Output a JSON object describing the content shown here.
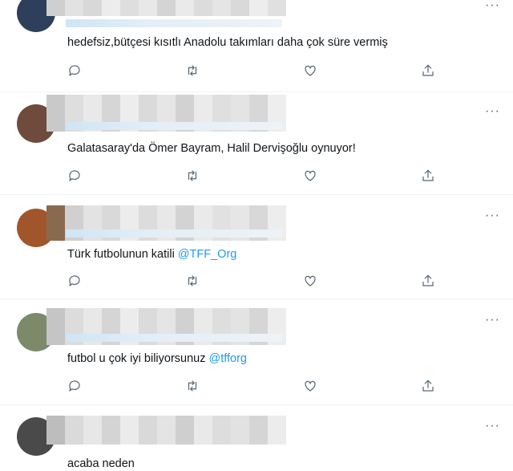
{
  "tweets": [
    {
      "text": "hedefsiz,bütçesi kısıtlı Anadolu takımları daha çok süre vermiş",
      "mention": "",
      "more_label": "···",
      "icons": [
        "reply-icon",
        "retweet-icon",
        "like-icon",
        "share-icon"
      ]
    },
    {
      "text": "Galatasaray'da Ömer Bayram, Halil Dervişoğlu oynuyor!",
      "mention": "",
      "more_label": "···",
      "icons": [
        "reply-icon",
        "retweet-icon",
        "like-icon",
        "share-icon"
      ]
    },
    {
      "text": "Türk futbolunun katili ",
      "mention": "@TFF_Org",
      "more_label": "···",
      "icons": [
        "reply-icon",
        "retweet-icon",
        "like-icon",
        "share-icon"
      ]
    },
    {
      "text": "futbol u çok iyi biliyorsunuz ",
      "mention": "@tfforg",
      "more_label": "···",
      "icons": [
        "reply-icon",
        "retweet-icon",
        "like-icon",
        "share-icon"
      ]
    },
    {
      "text": "acaba neden",
      "mention": "",
      "more_label": "···",
      "icons": []
    }
  ],
  "colors": {
    "mention": "#1d9bf0",
    "icon": "#536471",
    "divider": "#eff3f4"
  }
}
